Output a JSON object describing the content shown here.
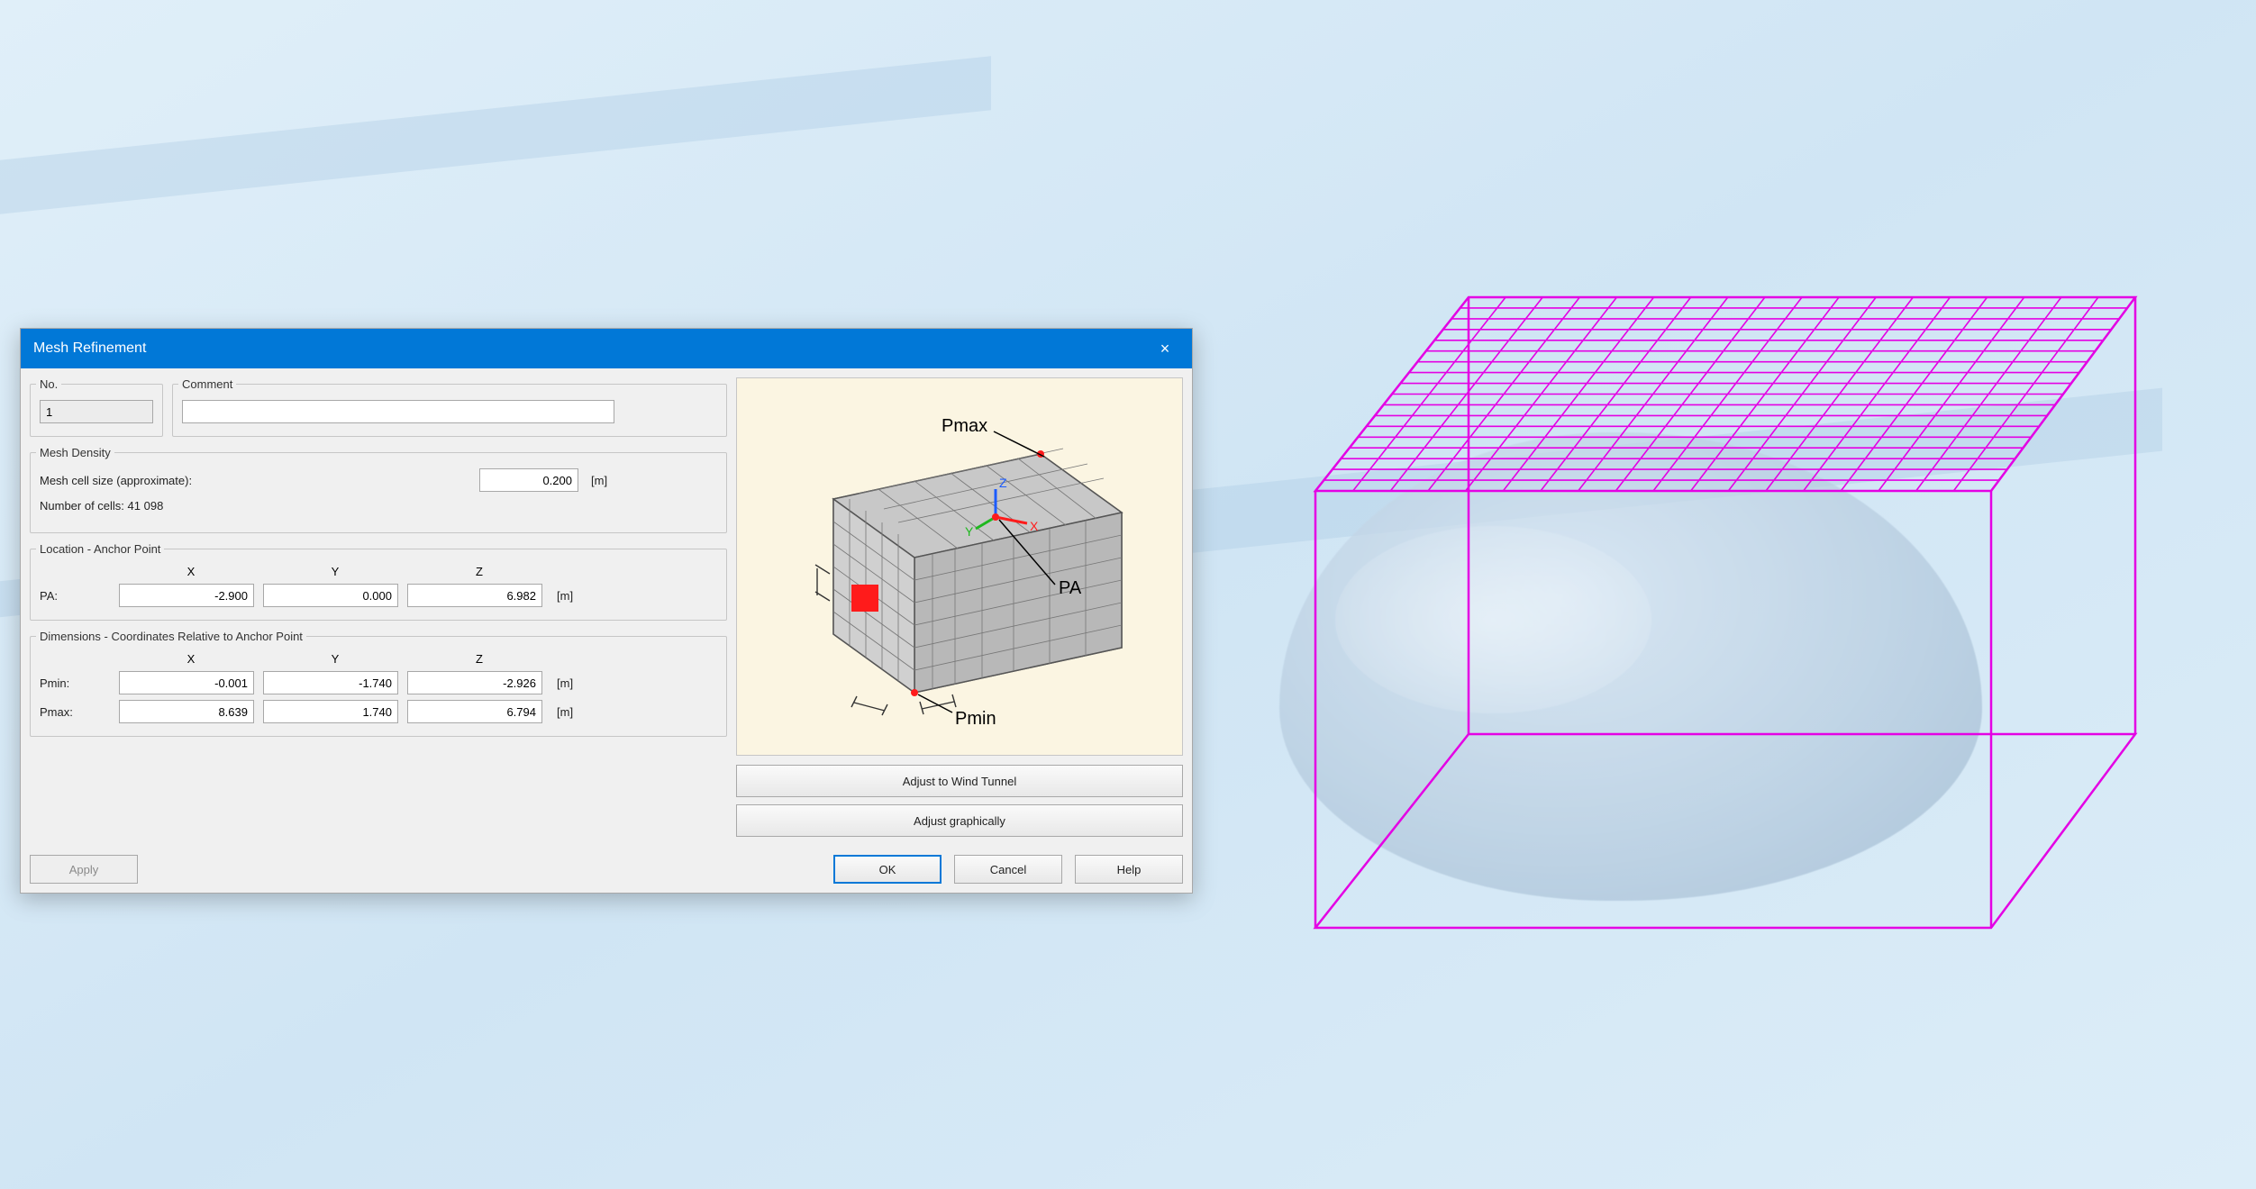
{
  "dialog": {
    "title": "Mesh Refinement",
    "close_icon": "×",
    "no_section": {
      "legend": "No.",
      "value": "1"
    },
    "comment_section": {
      "legend": "Comment",
      "value": ""
    },
    "density_section": {
      "legend": "Mesh Density",
      "cell_size_label": "Mesh cell size (approximate):",
      "cell_size_value": "0.200",
      "cell_size_unit": "[m]",
      "num_cells_label": "Number of cells: 41 098"
    },
    "location_section": {
      "legend": "Location - Anchor Point",
      "col_x": "X",
      "col_y": "Y",
      "col_z": "Z",
      "row_label": "PA:",
      "x": "-2.900",
      "y": "0.000",
      "z": "6.982",
      "unit": "[m]"
    },
    "dim_section": {
      "legend": "Dimensions - Coordinates Relative to Anchor Point",
      "col_x": "X",
      "col_y": "Y",
      "col_z": "Z",
      "pmin_label": "Pmin:",
      "pmin_x": "-0.001",
      "pmin_y": "-1.740",
      "pmin_z": "-2.926",
      "pmax_label": "Pmax:",
      "pmax_x": "8.639",
      "pmax_y": "1.740",
      "pmax_z": "6.794",
      "unit": "[m]"
    },
    "preview_labels": {
      "pmax": "Pmax",
      "pmin": "Pmin",
      "pa": "PA",
      "x": "X",
      "y": "Y",
      "z": "Z"
    },
    "buttons": {
      "adjust_wind": "Adjust to Wind Tunnel",
      "adjust_graph": "Adjust graphically",
      "apply": "Apply",
      "ok": "OK",
      "cancel": "Cancel",
      "help": "Help"
    }
  }
}
